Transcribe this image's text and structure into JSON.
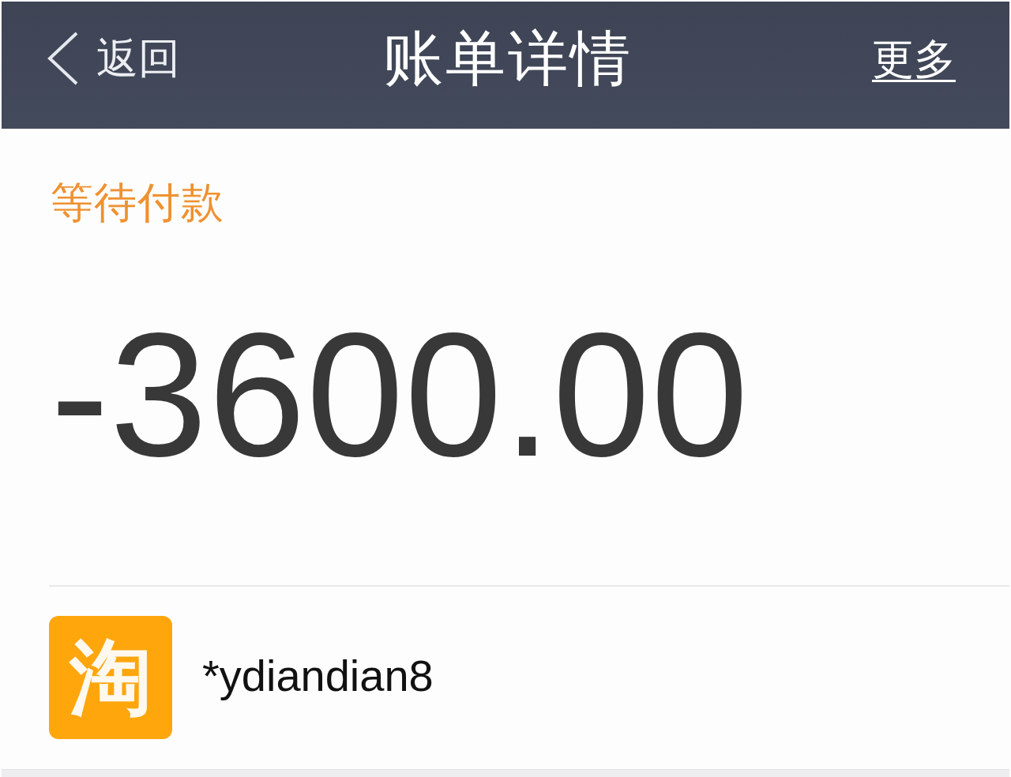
{
  "nav_bar": {
    "back_label": "返回",
    "title": "账单详情",
    "more_label": "更多"
  },
  "bill": {
    "status": "等待付款",
    "amount": "-3600.00"
  },
  "merchant": {
    "logo_text": "淘",
    "name": "*ydiandian8"
  }
}
